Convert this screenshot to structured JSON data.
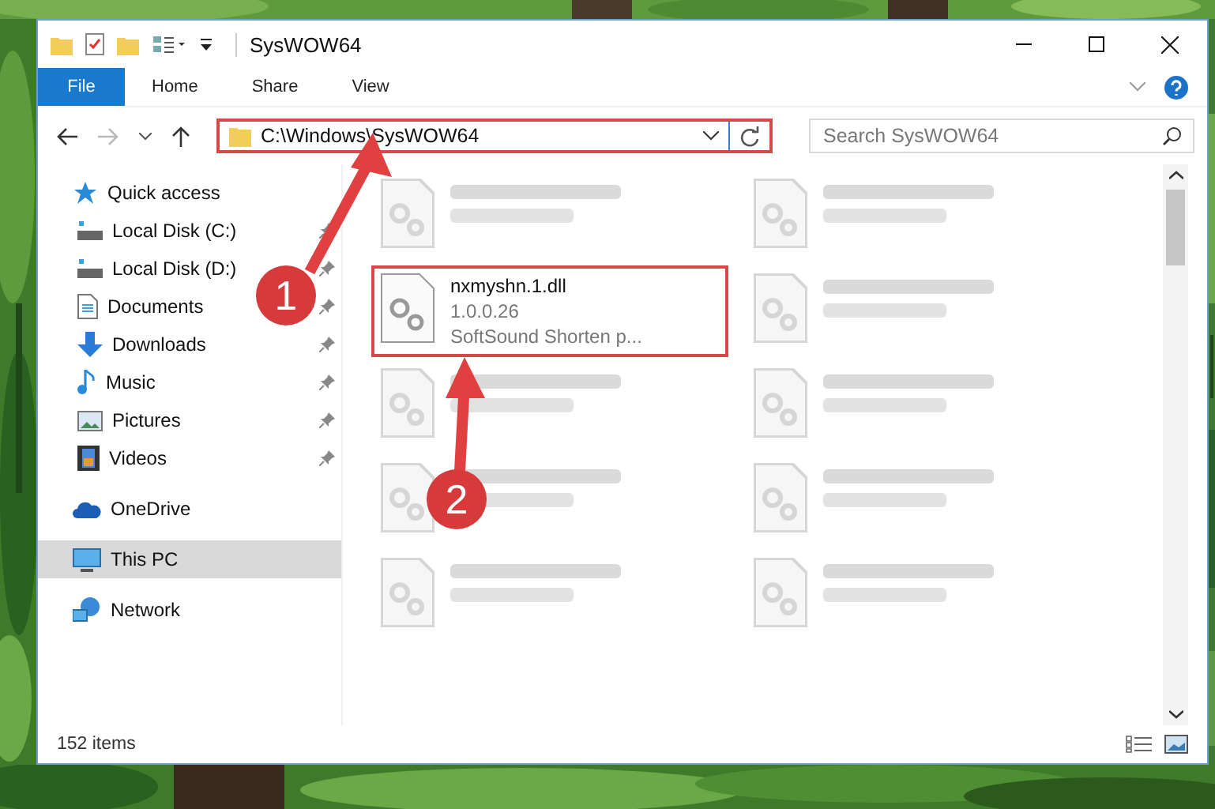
{
  "window": {
    "title": "SysWOW64"
  },
  "ribbon": {
    "tabs": [
      {
        "label": "File",
        "selected": true
      },
      {
        "label": "Home",
        "selected": false
      },
      {
        "label": "Share",
        "selected": false
      },
      {
        "label": "View",
        "selected": false
      }
    ]
  },
  "address": {
    "path": "C:\\Windows\\SysWOW64",
    "highlighted": true
  },
  "search": {
    "placeholder": "Search SysWOW64"
  },
  "nav": [
    {
      "label": "Quick access",
      "kind": "star",
      "selected": false,
      "children": [
        {
          "label": "Local Disk (C:)",
          "kind": "disk",
          "pinned": true,
          "selected": false
        },
        {
          "label": "Local Disk (D:)",
          "kind": "disk",
          "pinned": true,
          "selected": false
        },
        {
          "label": "Documents",
          "kind": "document",
          "pinned": true,
          "selected": false
        },
        {
          "label": "Downloads",
          "kind": "download",
          "pinned": true,
          "selected": false
        },
        {
          "label": "Music",
          "kind": "music",
          "pinned": true,
          "selected": false
        },
        {
          "label": "Pictures",
          "kind": "pictures",
          "pinned": true,
          "selected": false
        },
        {
          "label": "Videos",
          "kind": "video",
          "pinned": true,
          "selected": false
        }
      ]
    },
    {
      "label": "OneDrive",
      "kind": "cloud",
      "selected": false
    },
    {
      "label": "This PC",
      "kind": "pc",
      "selected": true
    },
    {
      "label": "Network",
      "kind": "network",
      "selected": false
    }
  ],
  "files": [
    {
      "kind": "blurred",
      "highlighted": false
    },
    {
      "kind": "blurred",
      "highlighted": false
    },
    {
      "kind": "file",
      "name": "nxmyshn.1.dll",
      "details": [
        "1.0.0.26",
        "SoftSound Shorten p..."
      ],
      "highlighted": true
    },
    {
      "kind": "blurred",
      "highlighted": false
    },
    {
      "kind": "blurred",
      "highlighted": false
    },
    {
      "kind": "blurred",
      "highlighted": false
    },
    {
      "kind": "blurred",
      "highlighted": false
    },
    {
      "kind": "blurred",
      "highlighted": false
    },
    {
      "kind": "blurred",
      "highlighted": false
    },
    {
      "kind": "blurred",
      "highlighted": false
    }
  ],
  "status_bar": {
    "item_count": "152 items"
  },
  "callouts": [
    {
      "number": "1"
    },
    {
      "number": "2"
    }
  ]
}
